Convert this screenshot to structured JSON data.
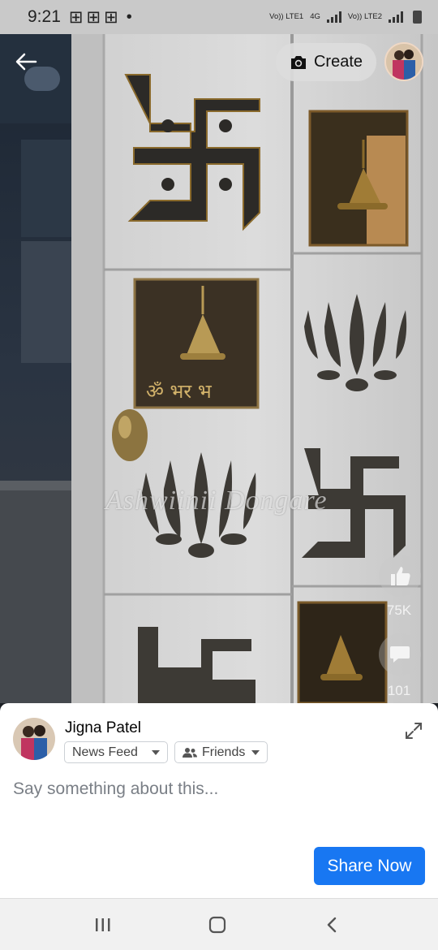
{
  "status_bar": {
    "time": "9:21",
    "notification_icons": [
      "⊞",
      "⊞",
      "⊞"
    ],
    "notification_dot": "•",
    "sim1_label": "Vo)) LTE1",
    "sim1_net": "4G",
    "sim2_label": "Vo)) LTE2"
  },
  "header": {
    "create_label": "Create",
    "back_icon": "arrow-left-icon",
    "camera_icon": "camera-icon"
  },
  "video": {
    "watermark": "Ashwiinii Dongare",
    "panel_text": "ॐ भर भ",
    "likes": "75K",
    "comments": "101"
  },
  "share_sheet": {
    "user_name": "Jigna Patel",
    "audience_feed": "News Feed",
    "audience_privacy": "Friends",
    "input_placeholder": "Say something about this...",
    "input_value": "",
    "share_button": "Share Now"
  },
  "colors": {
    "accent": "#1877f2",
    "sheet_bg": "#ffffff",
    "status_bar_bg": "#c9c9c9",
    "nav_bar_bg": "#f1f1f1"
  }
}
